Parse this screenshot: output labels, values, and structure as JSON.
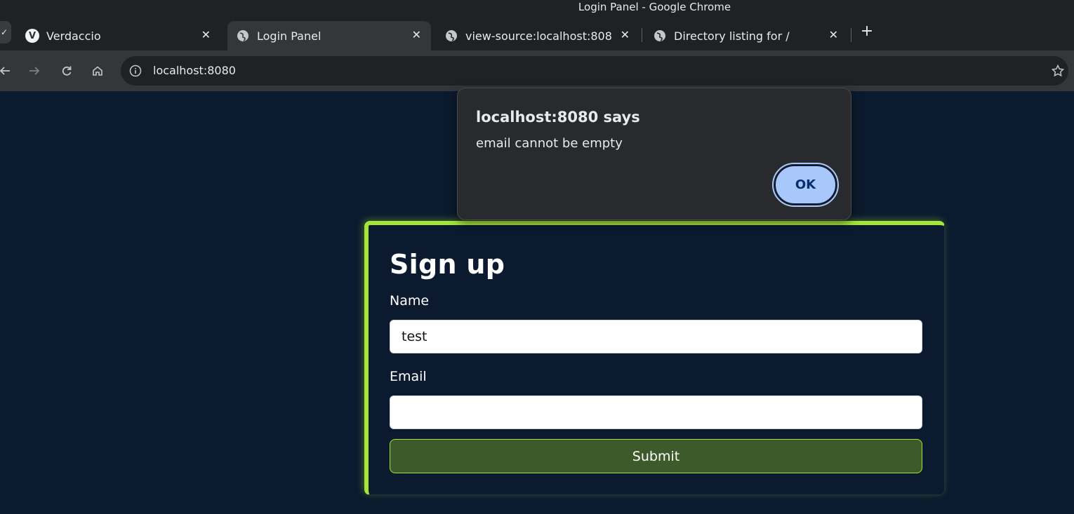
{
  "window": {
    "title": "Login Panel - Google Chrome"
  },
  "tabs": [
    {
      "label": "Verdaccio",
      "favicon": "verdaccio-logo-icon",
      "active": false
    },
    {
      "label": "Login Panel",
      "favicon": "globe-icon",
      "active": true
    },
    {
      "label": "view-source:localhost:8080",
      "favicon": "globe-icon",
      "active": false
    },
    {
      "label": "Directory listing for /",
      "favicon": "globe-icon",
      "active": false
    }
  ],
  "toolbar": {
    "url": "localhost:8080",
    "icons": [
      "back-arrow-icon",
      "forward-arrow-icon",
      "reload-icon",
      "home-icon",
      "info-icon",
      "bookmark-star-icon"
    ]
  },
  "dialog": {
    "title": "localhost:8080 says",
    "message": "email cannot be empty",
    "ok_label": "OK"
  },
  "form": {
    "title": "Sign up",
    "name_label": "Name",
    "name_value": "test",
    "email_label": "Email",
    "email_value": "",
    "submit_label": "Submit"
  },
  "colors": {
    "page_bg": "#0b1a2e",
    "accent": "#a3e635",
    "submit_bg": "#3d5a2a",
    "dialog_bg": "#292a2d",
    "ok_button": "#a8c7fa"
  }
}
